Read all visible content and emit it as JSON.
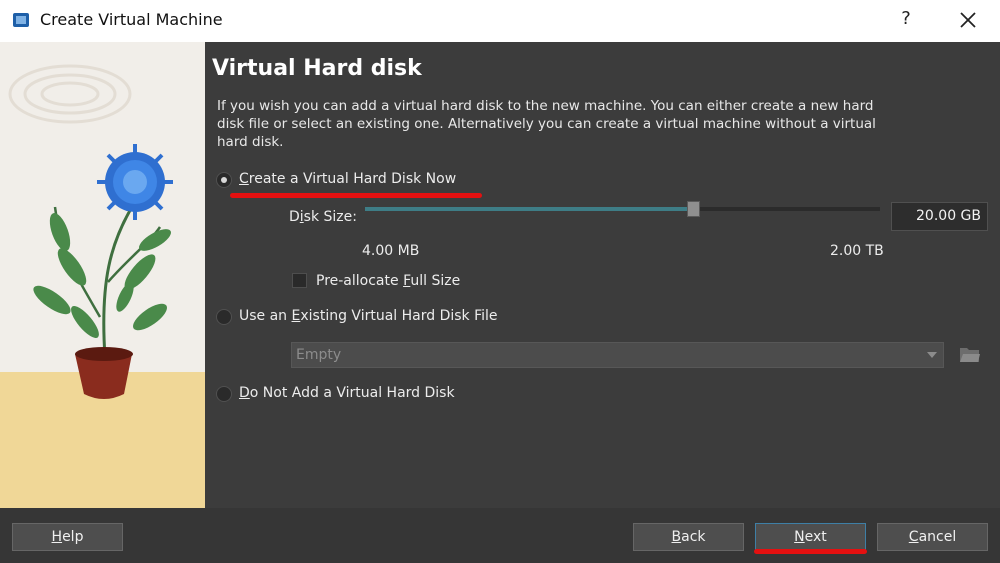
{
  "window": {
    "title": "Create Virtual Machine",
    "help_label": "?"
  },
  "page": {
    "heading": "Virtual Hard disk",
    "description": "If you wish you can add a virtual hard disk to the new machine. You can either create a new hard disk file or select an existing one. Alternatively you can create a virtual machine without a virtual hard disk."
  },
  "options": {
    "create_now": {
      "prefix": "",
      "mnemonic": "C",
      "suffix": "reate a Virtual Hard Disk Now",
      "selected": true
    },
    "use_existing": {
      "prefix": "Use an ",
      "mnemonic": "E",
      "suffix": "xisting Virtual Hard Disk File",
      "selected": false
    },
    "do_not_add": {
      "prefix": "",
      "mnemonic": "D",
      "suffix": "o Not Add a Virtual Hard Disk",
      "selected": false
    }
  },
  "disk_size": {
    "label_prefix": "D",
    "label_mnemonic": "i",
    "label_suffix": "sk Size:",
    "value": "20.00 GB",
    "min_label": "4.00 MB",
    "max_label": "2.00 TB",
    "slider_fraction": 0.64
  },
  "preallocate": {
    "prefix": "Pre-allocate ",
    "mnemonic": "F",
    "suffix": "ull Size",
    "checked": false
  },
  "existing_file": {
    "value": "Empty"
  },
  "buttons": {
    "help": {
      "prefix": "",
      "mnemonic": "H",
      "suffix": "elp"
    },
    "back": {
      "prefix": "",
      "mnemonic": "B",
      "suffix": "ack"
    },
    "next": {
      "prefix": "",
      "mnemonic": "N",
      "suffix": "ext"
    },
    "cancel": {
      "prefix": "",
      "mnemonic": "C",
      "suffix": "ancel"
    }
  },
  "colors": {
    "annotation_red": "#e41010",
    "slider_fill": "#3e7d86",
    "background": "#3c3c3c"
  }
}
